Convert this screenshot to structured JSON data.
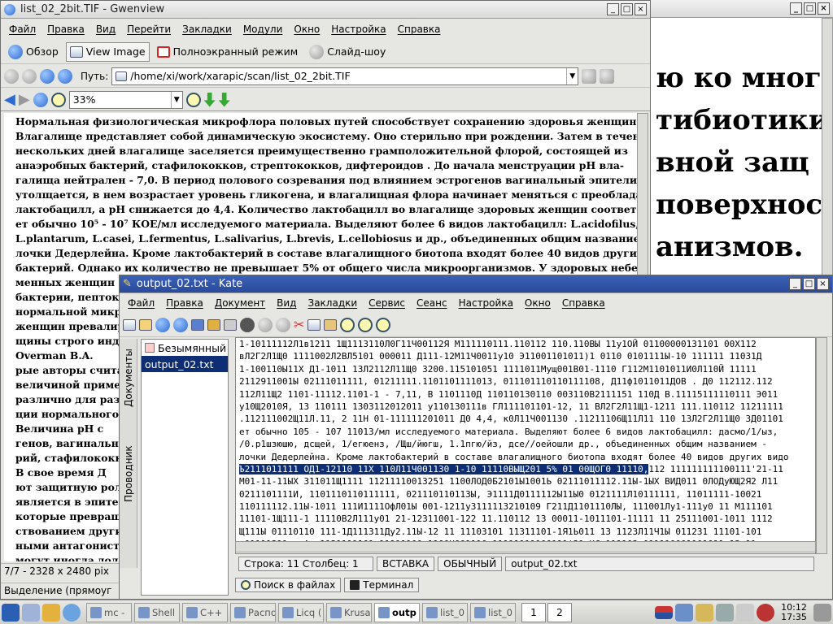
{
  "gwenview": {
    "title": "list_02_2bit.TIF - Gwenview",
    "menu": [
      "Файл",
      "Правка",
      "Вид",
      "Перейти",
      "Закладки",
      "Модули",
      "Окно",
      "Настройка",
      "Справка"
    ],
    "modes": {
      "browse": "Обзор",
      "view_image": "View Image",
      "fullscreen": "Полноэкранный режим",
      "slideshow": "Слайд-шоу"
    },
    "path_label": "Путь:",
    "path_value": "/home/xi/work/xarapic/scan/list_02_2bit.TIF",
    "zoom": "33%",
    "doc_lines": [
      "Нормальная физиологическая микрофлора половых путей способствует сохранению здоровья женщины.",
      "Влагалище представляет собой динамическую экосистему. Оно стерильно при рождении. Затем в течение",
      "нескольких дней влагалище заселяется преимущественно грамположительной флорой, состоящей из",
      "анаэробных бактерий, стафилококков, стрептококков, дифтероидов .          До начала менструации pH вла-",
      "галища нейтрален - 7,0. В период полового созревания под влиянием эстрогенов вагинальный эпителий",
      "утолщается, в нем возрастает уровень гликогена, и влагалищная флора начинает меняться с преобладанием",
      "лактобацилл, а pH снижается до 4,4. Количество лактобацилл во влагалище здоровых женщин соответству-",
      "ет обычно 10⁵ - 10⁷ КОЕ/мл исследуемого материала. Выделяют более 6 видов лактобацилл: L.acidofilus,",
      "L.plantarum, L.casei, L.fermentus, L.salivarius, L.brevis, L.cellobiosus и др., объединенных общим названием - па-",
      "лочки Дедерлейна. Кроме лактобактерий в составе влагалищного биотопа входят более 40 видов других видов",
      "бактерий. Однако их количество не превышает 5% от общего числа микроорганизмов. У здоровых небере-",
      "менных женщин",
      "бактерии, пепток",
      "нормальной микр",
      "женщин превалир",
      "щины строго инд",
      "Overman B.A.",
      "рые авторы счита",
      "величиной приме",
      "различно для рази",
      "ции нормального",
      "Величина pH с",
      "генов, вагинальн",
      "рий, стафилококк",
      "В свое время Д",
      "ют защитную рол",
      "является в эпите",
      "которые превращ",
      "ствованием други",
      "ными антагонист",
      "могут иногда дол"
    ],
    "status_info": "7/7 - 2328 x 2480 pix",
    "status_sel": "Выделение (прямоуг"
  },
  "bg_scan_lines": [
    "ю ко мног",
    "тибиотики",
    "вной защ",
    "поверхнос",
    "анизмов."
  ],
  "kate": {
    "title": "output_02.txt - Kate",
    "menu": [
      "Файл",
      "Правка",
      "Документ",
      "Вид",
      "Закладки",
      "Сервис",
      "Сеанс",
      "Настройка",
      "Окно",
      "Справка"
    ],
    "side_tabs": {
      "documents": "Документы",
      "explorer": "Проводник"
    },
    "files": [
      "Безымянный",
      "output_02.txt"
    ],
    "lines": [
      "1-10111112Л1в1211 1Щ1113110Л0Г11Ч00112Я М111110111.110112 110.110ВЫ 11у1ОЙ 01100000131101 00Х112",
      "вЛ2Г2Л1Щ0 1111002Л2ВЛ5101 000011 Д111-12М11Ч0011у10 Э11001101011)1 0110 0101111Ы-10 111111 110З1Д",
      "1-100110Ы11Х Д1-1011 13Л2112Л11Щ0 3200.115101051 1111011Мущ001В01-1110 Г112М1101011И0Л110Й 11111",
      "2112911001Ы 02111011111, 01211111.1101101111013, 011101110110111108, Д11ф1011011ДОВ . Д0 112112.112",
      "112Л11Щ2 1101-11112.1101-1 - 7,11, В 1101110Д 110110130110 003110В2111151 110Д В.11115111110111 Э011",
      "у10Щ2010Я, 13 110111 1303112012011 у110130111в ГЛ111101101-12, 11 ВЛ2Г2Л11Щ1-1211 111.110112 11211111",
      ".112111002Щ11Л.11, 2 11Н 01-111111201011 Д0 4,4, к0Л11Ч001130 .11211106Щ11Л11 110 13Л2Г2Л11Щ0 3Д01101",
      "ет обычно 105 - 107 11013/мл исследуемого материала. Выделяют более 6 видов лактобацилл: дасмо/1/ыз,",
      "/0.р1шзюшю, дсщей, 1/егюенз, /Щш/йюгш, 1.1пгю/йз, дсе//оейошли др., объединенных общим названием -",
      "лочки Дедерлейна. Кроме лактобактерий в составе влагалищного биотопа входят более 40 видов других видо",
      "Ъ2111011111 ОД1-12110 11Х 110Л11Ч001130 1-10 11110ВЫЩ201 5% 01 00ЩОГ0 11110,112 111111111100111'21-11",
      "М01-11-11ЫХ 311011Щ1111 11211110013251 1100ЛОД0Б2101Ы1001Ь 02111011112.11Ы-1ЫХ ВИД011 0ЛОДуЮЩ2Я2 Л11",
      "0211101111И, 1101110110111111, 021110110113Ы, Э1111Д0111112Ы11Ы0 0121111Л10111111, 11011111-10021",
      "110111112.11Ы-1011 111И1111ОфЛ01Ы 001-1211у3111113210109 Г211Д1101110ЛЫ, 111001Лу1-111у0 11 М111101",
      "11101-1Щ111-1 11110В2Л111у01 21-12311001-122 11.110112 13 00011-1011101-11111 11 25111001-1011 1112",
      "Щ111Ы 01110110 111-1Д111311Ду2.11Ы-12 11 11103101 11311101-1Я1Ь011 13 1123Л11Ч1Ы 011231 11101-101",
      "у01111211 в А. 1121111101-11111100 1100Ч001110 11111111100111'21-ИС-111103 011110001101011 13 11"
    ],
    "highlight_prefix": "Ъ2111011111 ОД1-12110 11Х 110Л11Ч001130 1-10 11110ВЫЩ201 5% 01 00ЩОГ0 11110,",
    "highlight_suffix": "112 111111111100111'21-11",
    "status": {
      "position": "Строка: 11 Столбец: 1",
      "mode": "ВСТАВКА",
      "input": "ОБЫЧНЫЙ",
      "file": "output_02.txt"
    },
    "bottom_tabs": {
      "find": "Поиск в файлах",
      "terminal": "Терминал"
    }
  },
  "taskbar": {
    "tasks": [
      {
        "label": "mc - ",
        "active": false
      },
      {
        "label": "Shell",
        "active": false
      },
      {
        "label": "C++",
        "active": false
      },
      {
        "label": "Распо",
        "active": false
      },
      {
        "label": "Licq (",
        "active": false
      },
      {
        "label": "Krusa",
        "active": false
      },
      {
        "label": "outp",
        "active": true
      },
      {
        "label": "list_0",
        "active": false
      },
      {
        "label": "list_0",
        "active": false
      }
    ],
    "pager": [
      "1",
      "2"
    ],
    "clock": [
      "10:12",
      "17:35"
    ]
  }
}
